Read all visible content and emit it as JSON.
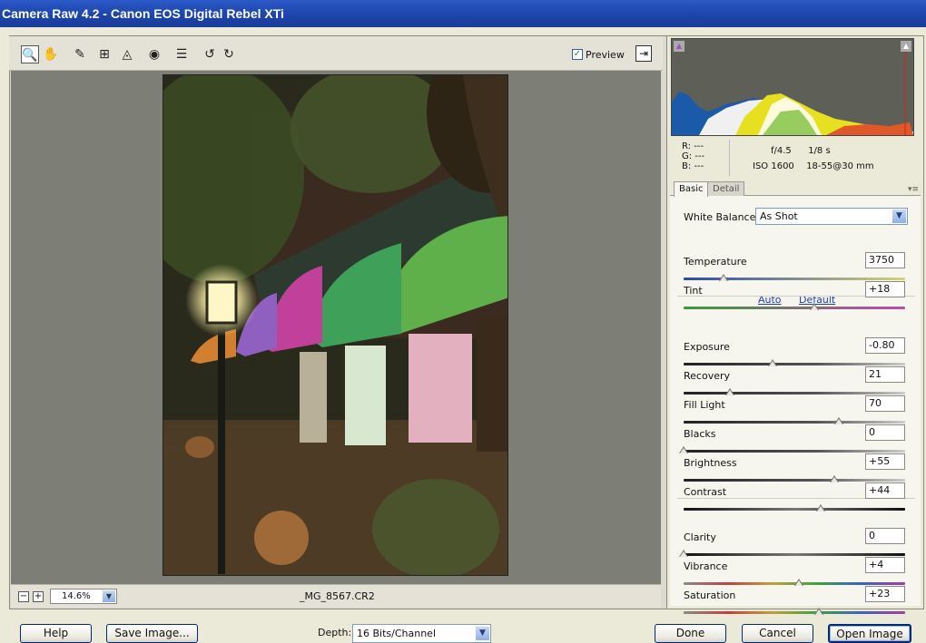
{
  "window": {
    "title": "Camera Raw 4.2  -  Canon EOS Digital Rebel XTi"
  },
  "toolbar": {
    "tools": [
      {
        "name": "zoom-tool-icon",
        "glyph": "🔍"
      },
      {
        "name": "hand-tool-icon",
        "glyph": "✋"
      },
      {
        "name": "white-balance-tool-icon",
        "glyph": "✎"
      },
      {
        "name": "crop-tool-icon",
        "glyph": "⊞"
      },
      {
        "name": "straighten-tool-icon",
        "glyph": "◬"
      },
      {
        "name": "red-eye-tool-icon",
        "glyph": "◉"
      },
      {
        "name": "preferences-icon",
        "glyph": "☰"
      },
      {
        "name": "rotate-left-icon",
        "glyph": "↺"
      },
      {
        "name": "rotate-right-icon",
        "glyph": "↻"
      }
    ],
    "preview_label": "Preview",
    "preview_checked": true
  },
  "status": {
    "zoom": "14.6%",
    "filename": "_MG_8567.CR2"
  },
  "info": {
    "r": "R:  ---",
    "g": "G:  ---",
    "b": "B:  ---",
    "aperture": "f/4.5",
    "shutter": "1/8 s",
    "iso": "ISO 1600",
    "lens": "18-55@30 mm"
  },
  "tabs": [
    "Basic",
    "Detail"
  ],
  "basic": {
    "white_balance_label": "White Balance:",
    "white_balance_value": "As Shot",
    "auto": "Auto",
    "default": "Default",
    "sliders": [
      {
        "id": "temperature",
        "label": "Temperature",
        "value": "3750",
        "pos": 0.18
      },
      {
        "id": "tint",
        "label": "Tint",
        "value": "+18",
        "pos": 0.59
      },
      {
        "id": "exposure",
        "label": "Exposure",
        "value": "-0.80",
        "pos": 0.4
      },
      {
        "id": "recovery",
        "label": "Recovery",
        "value": "21",
        "pos": 0.21
      },
      {
        "id": "fill-light",
        "label": "Fill Light",
        "value": "70",
        "pos": 0.7
      },
      {
        "id": "blacks",
        "label": "Blacks",
        "value": "0",
        "pos": 0.0
      },
      {
        "id": "brightness",
        "label": "Brightness",
        "value": "+55",
        "pos": 0.68
      },
      {
        "id": "contrast",
        "label": "Contrast",
        "value": "+44",
        "pos": 0.62
      },
      {
        "id": "clarity",
        "label": "Clarity",
        "value": "0",
        "pos": 0.0
      },
      {
        "id": "vibrance",
        "label": "Vibrance",
        "value": "+4",
        "pos": 0.52
      },
      {
        "id": "saturation",
        "label": "Saturation",
        "value": "+23",
        "pos": 0.61
      }
    ]
  },
  "bottom": {
    "help": "Help",
    "save": "Save Image...",
    "depth_label": "Depth:",
    "depth_value": "16 Bits/Channel",
    "done": "Done",
    "cancel": "Cancel",
    "open": "Open Image"
  }
}
